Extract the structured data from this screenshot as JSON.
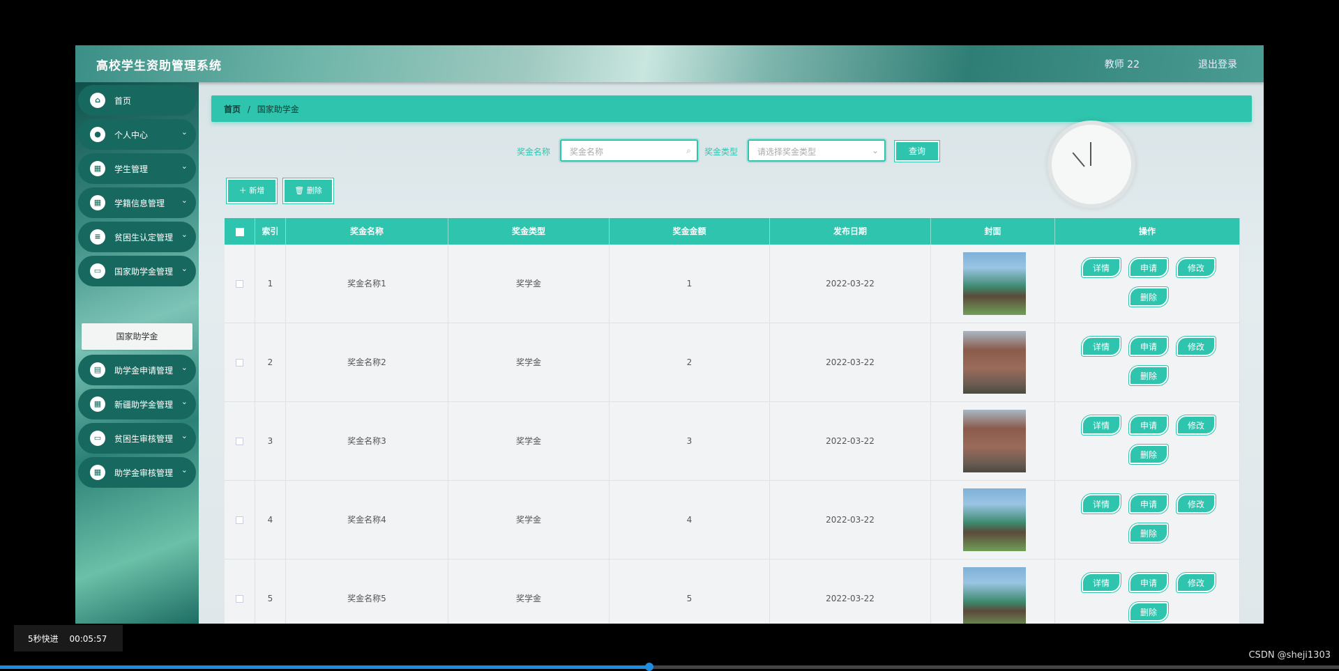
{
  "header": {
    "title": "高校学生资助管理系统",
    "user": "教师 22",
    "logout": "退出登录"
  },
  "sidebar": {
    "items": [
      {
        "label": "首页",
        "icon": "home-icon",
        "glyph": "⌂",
        "expandable": false
      },
      {
        "label": "个人中心",
        "icon": "user-icon",
        "glyph": "●",
        "expandable": true
      },
      {
        "label": "学生管理",
        "icon": "grid-icon",
        "glyph": "▦",
        "expandable": true
      },
      {
        "label": "学籍信息管理",
        "icon": "grid-icon",
        "glyph": "▦",
        "expandable": true
      },
      {
        "label": "贫困生认定管理",
        "icon": "list-icon",
        "glyph": "≡",
        "expandable": true
      },
      {
        "label": "国家助学金管理",
        "icon": "monitor-icon",
        "glyph": "▭",
        "expandable": true
      },
      {
        "label": "助学金申请管理",
        "icon": "clipboard-icon",
        "glyph": "▤",
        "expandable": true
      },
      {
        "label": "新疆助学金管理",
        "icon": "grid-icon",
        "glyph": "▦",
        "expandable": true
      },
      {
        "label": "贫困生审核管理",
        "icon": "monitor-icon",
        "glyph": "▭",
        "expandable": true
      },
      {
        "label": "助学金审核管理",
        "icon": "grid-icon",
        "glyph": "▦",
        "expandable": true
      }
    ],
    "submenu_active": "国家助学金"
  },
  "breadcrumb": {
    "home": "首页",
    "sep": "/",
    "current": "国家助学金"
  },
  "search": {
    "name_label": "奖金名称",
    "name_placeholder": "奖金名称",
    "type_label": "奖金类型",
    "type_placeholder": "请选择奖金类型",
    "query_button": "查询"
  },
  "actions": {
    "add": "＋ 新增",
    "delete": "🗑 删除"
  },
  "table": {
    "columns": [
      "索引",
      "奖金名称",
      "奖金类型",
      "奖金金额",
      "发布日期",
      "封面",
      "操作"
    ],
    "rows": [
      {
        "index": "1",
        "name": "奖金名称1",
        "type": "奖学金",
        "amount": "1",
        "date": "2022-03-22",
        "cover": "a"
      },
      {
        "index": "2",
        "name": "奖金名称2",
        "type": "奖学金",
        "amount": "2",
        "date": "2022-03-22",
        "cover": "b"
      },
      {
        "index": "3",
        "name": "奖金名称3",
        "type": "奖学金",
        "amount": "3",
        "date": "2022-03-22",
        "cover": "b"
      },
      {
        "index": "4",
        "name": "奖金名称4",
        "type": "奖学金",
        "amount": "4",
        "date": "2022-03-22",
        "cover": "a"
      },
      {
        "index": "5",
        "name": "奖金名称5",
        "type": "奖学金",
        "amount": "5",
        "date": "2022-03-22",
        "cover": "a"
      }
    ],
    "row_actions": [
      "详情",
      "申请",
      "修改",
      "删除"
    ]
  },
  "player": {
    "skip": "5秒快进",
    "time": "00:05:57",
    "progress": 0.485
  },
  "credit": "CSDN @sheji1303",
  "colors": {
    "accent": "#2fc4ad",
    "sidebar_item": "#17695f",
    "progress": "#1e8ce0"
  }
}
